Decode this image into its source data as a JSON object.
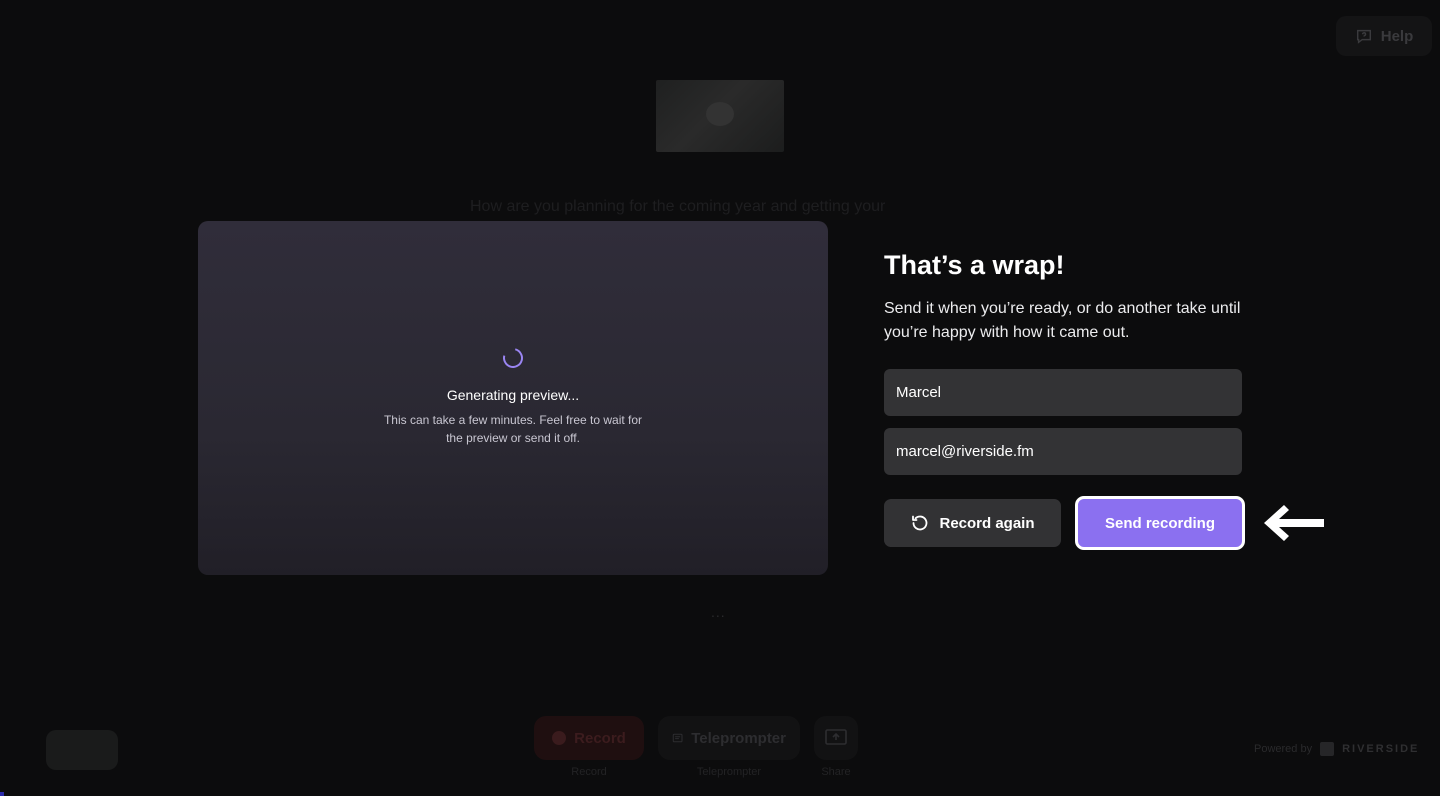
{
  "help": {
    "label": "Help",
    "icon": "help-chat-icon"
  },
  "background": {
    "question": "How are you planning for the coming year and getting your",
    "dots": "...",
    "toolbar": {
      "record_label": "Record",
      "record_caption": "Record",
      "teleprompter_label": "Teleprompter",
      "teleprompter_caption": "Teleprompter",
      "share_caption": "Share"
    },
    "powered_by": "Powered by",
    "brand": "RIVERSIDE"
  },
  "preview": {
    "title": "Generating preview...",
    "subtitle": "This can take a few minutes. Feel free to wait for the preview or send it off."
  },
  "form": {
    "heading": "That’s a wrap!",
    "description": "Send it when you’re ready, or do another take until you’re happy with how it came out.",
    "name_value": "Marcel",
    "email_value": "marcel@riverside.fm",
    "record_again_label": "Record again",
    "send_label": "Send recording"
  },
  "colors": {
    "accent": "#8b70f0",
    "background": "#0c0c0d",
    "field": "#333335"
  }
}
